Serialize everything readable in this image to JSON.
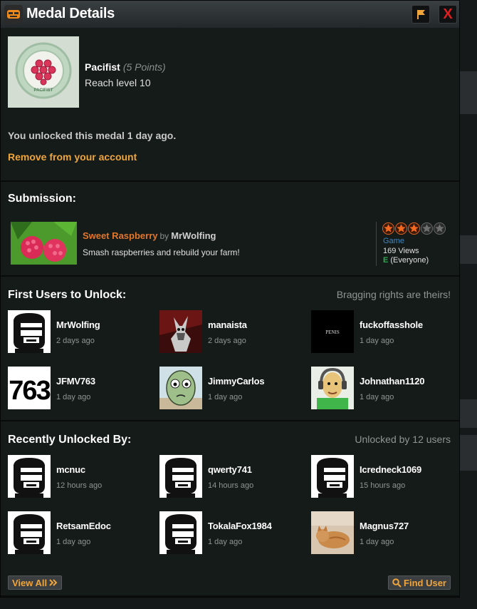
{
  "window": {
    "title": "Medal Details",
    "flag_icon": "flag-icon",
    "close_label": "X"
  },
  "medal": {
    "name": "Pacifist",
    "points": "(5 Points)",
    "description": "Reach level 10",
    "badge_text": "PACIFIST",
    "unlocked_text": "You unlocked this medal 1 day ago.",
    "remove_link": "Remove from your account"
  },
  "submission": {
    "heading": "Submission:",
    "title": "Sweet Raspberry",
    "by": "by",
    "author": "MrWolfing",
    "description": "Smash raspberries and rebuild your farm!",
    "rating_stars": 3,
    "rating_max": 5,
    "type": "Game",
    "views": "169 Views",
    "esrb_icon": "E",
    "content_rating": "(Everyone)"
  },
  "first_users": {
    "heading": "First Users to Unlock:",
    "note": "Bragging rights are theirs!",
    "users": [
      {
        "name": "MrWolfing",
        "time": "2 days ago",
        "avatar": "default-avatar"
      },
      {
        "name": "manaista",
        "time": "2 days ago",
        "avatar": "armored-creature-avatar"
      },
      {
        "name": "fuckoffasshole",
        "time": "1 day ago",
        "avatar": "black-text-avatar",
        "avatar_text": "PENIS"
      },
      {
        "name": "JFMV763",
        "time": "1 day ago",
        "avatar": "number-avatar",
        "avatar_text": "763"
      },
      {
        "name": "JimmyCarlos",
        "time": "1 day ago",
        "avatar": "green-face-avatar"
      },
      {
        "name": "Johnathan1120",
        "time": "1 day ago",
        "avatar": "headphones-character-avatar"
      }
    ]
  },
  "recent": {
    "heading": "Recently Unlocked By:",
    "note": "Unlocked by 12 users",
    "users": [
      {
        "name": "mcnuc",
        "time": "12 hours ago",
        "avatar": "default-avatar"
      },
      {
        "name": "qwerty741",
        "time": "14 hours ago",
        "avatar": "default-avatar"
      },
      {
        "name": "Icredneck1069",
        "time": "15 hours ago",
        "avatar": "default-avatar"
      },
      {
        "name": "RetsamEdoc",
        "time": "1 day ago",
        "avatar": "default-avatar"
      },
      {
        "name": "TokalaFox1984",
        "time": "1 day ago",
        "avatar": "default-avatar"
      },
      {
        "name": "Magnus727",
        "time": "1 day ago",
        "avatar": "cat-photo-avatar"
      }
    ],
    "view_all": "View All",
    "find_user": "Find User"
  },
  "colors": {
    "accent_orange": "#f0a53c",
    "game_title": "#e2762b",
    "link_blue": "#3d87c6",
    "close_red": "#e02020"
  }
}
